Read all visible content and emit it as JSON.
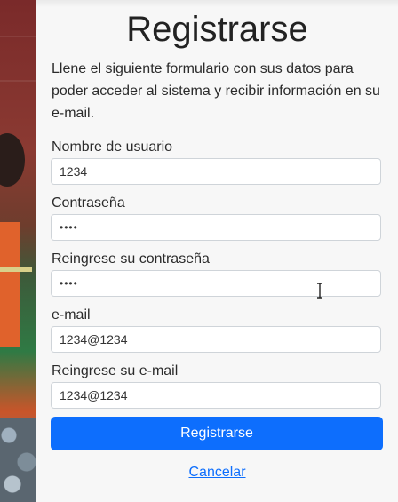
{
  "form": {
    "title": "Registrarse",
    "intro": "Llene el siguiente formulario con sus datos para poder acceder al sistema y recibir información en su e-mail.",
    "fields": [
      {
        "label": "Nombre de usuario",
        "value": "1234"
      },
      {
        "label": "Contraseña",
        "value": "••••"
      },
      {
        "label": "Reingrese su contraseña",
        "value": "••••"
      },
      {
        "label": "e-mail",
        "value": "1234@1234"
      },
      {
        "label": "Reingrese su e-mail",
        "value": "1234@1234"
      }
    ],
    "submit_label": "Registrarse",
    "cancel_label": "Cancelar"
  },
  "colors": {
    "primary": "#0d6efd",
    "panel_background": "#f7f7f7",
    "text": "#2b2b2b"
  },
  "icons": {
    "mouse_cursor": "text-cursor-icon"
  }
}
